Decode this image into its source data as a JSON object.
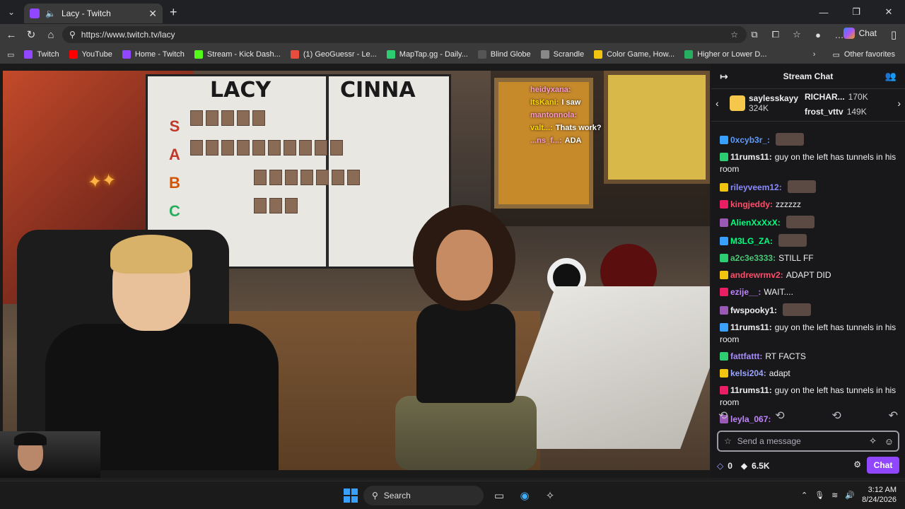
{
  "browser": {
    "tab_title": "Lacy - Twitch",
    "url": "https://www.twitch.tv/lacy",
    "copilot_label": "Chat",
    "bookmarks": [
      {
        "label": "Twitch",
        "color": "#9146ff"
      },
      {
        "label": "YouTube",
        "color": "#ff0000"
      },
      {
        "label": "Home - Twitch",
        "color": "#9146ff"
      },
      {
        "label": "Stream - Kick Dash...",
        "color": "#53fc18"
      },
      {
        "label": "(1) GeoGuessr - Le...",
        "color": "#e74c3c"
      },
      {
        "label": "MapTap.gg - Daily...",
        "color": "#2ecc71"
      },
      {
        "label": "Blind Globe",
        "color": "#555555"
      },
      {
        "label": "Scrandle",
        "color": "#888888"
      },
      {
        "label": "Color Game, How...",
        "color": "#f1c40f"
      },
      {
        "label": "Higher or Lower D...",
        "color": "#27ae60"
      }
    ],
    "other_favorites": "Other favorites"
  },
  "stream": {
    "board_left": "LACY",
    "board_right": "CINNA",
    "tiers": [
      "S",
      "A",
      "B",
      "C"
    ],
    "overlay_chat": [
      {
        "user": "heidyxana:",
        "text": ""
      },
      {
        "user": "ItsKani:",
        "text": "I saw"
      },
      {
        "user": "mantonnola:",
        "text": ""
      },
      {
        "user": "valt...:",
        "text": "Thats work?"
      },
      {
        "user": "...ns_f...:",
        "text": "ADA"
      }
    ]
  },
  "chat": {
    "title": "Stream Chat",
    "leaders": [
      {
        "name": "saylesskayy",
        "count": "324K"
      },
      {
        "name": "RICHAR...",
        "count": "170K"
      },
      {
        "name": "frost_vttv",
        "count": "149K"
      }
    ],
    "messages": [
      {
        "user": "0xcyb3r_:",
        "text": "",
        "color": "#5e9cff",
        "emote": true
      },
      {
        "user": "11rums11:",
        "text": "guy on the left has tunnels in his room",
        "color": "#efeff1",
        "emote": false
      },
      {
        "user": "rileyveem12:",
        "text": "",
        "color": "#8a8aff",
        "emote": true
      },
      {
        "user": "kingjeddy:",
        "text": "zzzzzz",
        "color": "#ff4e6a",
        "emote": false
      },
      {
        "user": "AlienXxXxX:",
        "text": "",
        "color": "#00ff7f",
        "emote": true
      },
      {
        "user": "M3LG_ZA:",
        "text": "",
        "color": "#00ff7f",
        "emote": true
      },
      {
        "user": "a2c3e3333:",
        "text": "STILL FF",
        "color": "#48c774",
        "emote": false
      },
      {
        "user": "andrewrmv2:",
        "text": "ADAPT DID",
        "color": "#ff4e6a",
        "emote": false
      },
      {
        "user": "ezije__:",
        "text": "WAIT....",
        "color": "#c084fc",
        "emote": false
      },
      {
        "user": "fwspooky1:",
        "text": "",
        "color": "#efeff1",
        "emote": true
      },
      {
        "user": "11rums11:",
        "text": "guy on the left has tunnels in his room",
        "color": "#efeff1",
        "emote": false
      },
      {
        "user": "fattfattt:",
        "text": "RT FACTS",
        "color": "#a78bfa",
        "emote": false
      },
      {
        "user": "kelsi204:",
        "text": "adapt",
        "color": "#9aa4ff",
        "emote": false
      },
      {
        "user": "11rums11:",
        "text": "guy on the left has tunnels in his room",
        "color": "#efeff1",
        "emote": false
      },
      {
        "user": "leyla_067:",
        "text": "",
        "color": "#c084fc",
        "emote": false
      }
    ],
    "input_placeholder": "Send a message",
    "points": "0",
    "bits": "6.5K",
    "chat_button": "Chat"
  },
  "taskbar": {
    "search_label": "Search",
    "time": "3:12 AM",
    "date": "8/24/2026"
  }
}
